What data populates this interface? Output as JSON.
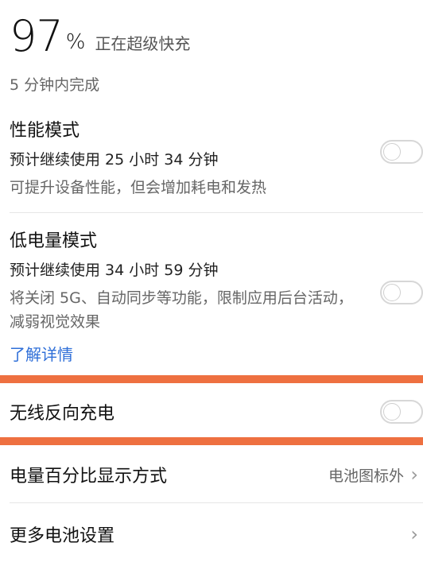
{
  "battery": {
    "level": "97",
    "percent_sign": "%",
    "status": "正在超级快充",
    "finish_time": "5 分钟内完成"
  },
  "performance_mode": {
    "title": "性能模式",
    "estimate": "预计继续使用 25 小时 34 分钟",
    "description": "可提升设备性能，但会增加耗电和发热",
    "enabled": false
  },
  "low_power_mode": {
    "title": "低电量模式",
    "estimate": "预计继续使用 34 小时 59 分钟",
    "description": "将关闭 5G、自动同步等功能，限制应用后台活动，减弱视觉效果",
    "learn_more": "了解详情",
    "enabled": false
  },
  "wireless_reverse_charging": {
    "title": "无线反向充电",
    "enabled": false
  },
  "percentage_display": {
    "title": "电量百分比显示方式",
    "value": "电池图标外"
  },
  "more_settings": {
    "title": "更多电池设置"
  },
  "colors": {
    "accent_highlight": "#ee7040",
    "link": "#2f6fd8"
  },
  "icons": {
    "chevron": "chevron-right-icon"
  }
}
